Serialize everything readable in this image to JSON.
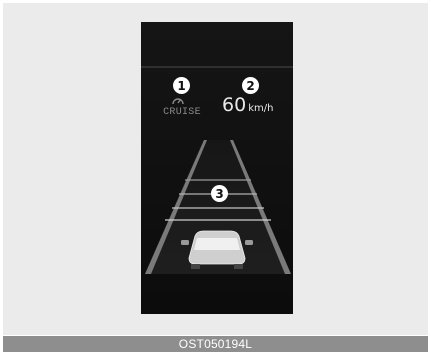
{
  "display": {
    "cruise_label": "CRUISE",
    "speed_value": "60",
    "speed_unit": "km/h"
  },
  "callouts": [
    "1",
    "2",
    "3"
  ],
  "caption": "OST050194L",
  "colors": {
    "background": "#ebebeb",
    "panel": "#101010",
    "caption_bar": "#8e8e8e",
    "road_lines": "#9a9a9a",
    "car": "#d8d8d8"
  },
  "icons": [
    "cruise-indicator-icon",
    "vehicle-icon"
  ]
}
